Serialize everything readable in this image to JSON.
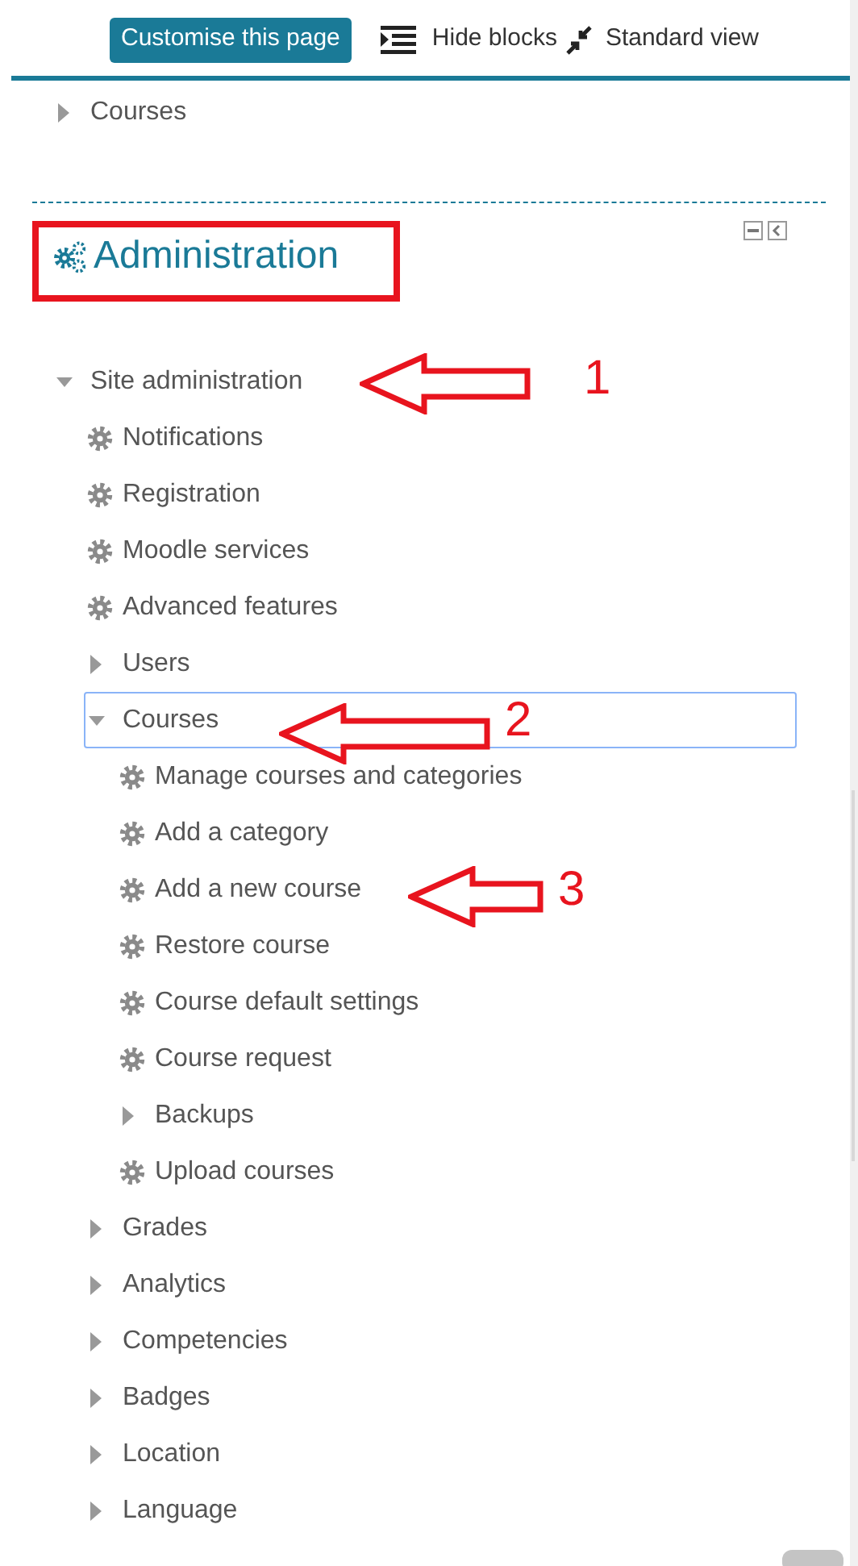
{
  "toolbar": {
    "customise_button": "Customise this page",
    "hide_blocks": "Hide blocks",
    "standard_view": "Standard view"
  },
  "navigation": {
    "items": [
      {
        "label": "Courses",
        "kind": "branch",
        "expanded": false
      }
    ]
  },
  "administration": {
    "title": "Administration",
    "tree": [
      {
        "label": "Site administration",
        "kind": "branch",
        "expanded": true,
        "selected": false,
        "children": [
          {
            "label": "Notifications",
            "kind": "leaf",
            "selected": false
          },
          {
            "label": "Registration",
            "kind": "leaf",
            "selected": false
          },
          {
            "label": "Moodle services",
            "kind": "leaf",
            "selected": false
          },
          {
            "label": "Advanced features",
            "kind": "leaf",
            "selected": false
          },
          {
            "label": "Users",
            "kind": "branch",
            "expanded": false,
            "selected": false
          },
          {
            "label": "Courses",
            "kind": "branch",
            "expanded": true,
            "selected": true,
            "children": [
              {
                "label": "Manage courses and categories",
                "kind": "leaf",
                "selected": false
              },
              {
                "label": "Add a category",
                "kind": "leaf",
                "selected": false
              },
              {
                "label": "Add a new course",
                "kind": "leaf",
                "selected": false
              },
              {
                "label": "Restore course",
                "kind": "leaf",
                "selected": false
              },
              {
                "label": "Course default settings",
                "kind": "leaf",
                "selected": false
              },
              {
                "label": "Course request",
                "kind": "leaf",
                "selected": false
              },
              {
                "label": "Backups",
                "kind": "branch",
                "expanded": false,
                "selected": false
              },
              {
                "label": "Upload courses",
                "kind": "leaf",
                "selected": false
              }
            ]
          },
          {
            "label": "Grades",
            "kind": "branch",
            "expanded": false,
            "selected": false
          },
          {
            "label": "Analytics",
            "kind": "branch",
            "expanded": false,
            "selected": false
          },
          {
            "label": "Competencies",
            "kind": "branch",
            "expanded": false,
            "selected": false
          },
          {
            "label": "Badges",
            "kind": "branch",
            "expanded": false,
            "selected": false
          },
          {
            "label": "Location",
            "kind": "branch",
            "expanded": false,
            "selected": false
          },
          {
            "label": "Language",
            "kind": "branch",
            "expanded": false,
            "selected": false
          }
        ]
      }
    ]
  },
  "annotations": [
    {
      "label": "1"
    },
    {
      "label": "2"
    },
    {
      "label": "3"
    }
  ]
}
